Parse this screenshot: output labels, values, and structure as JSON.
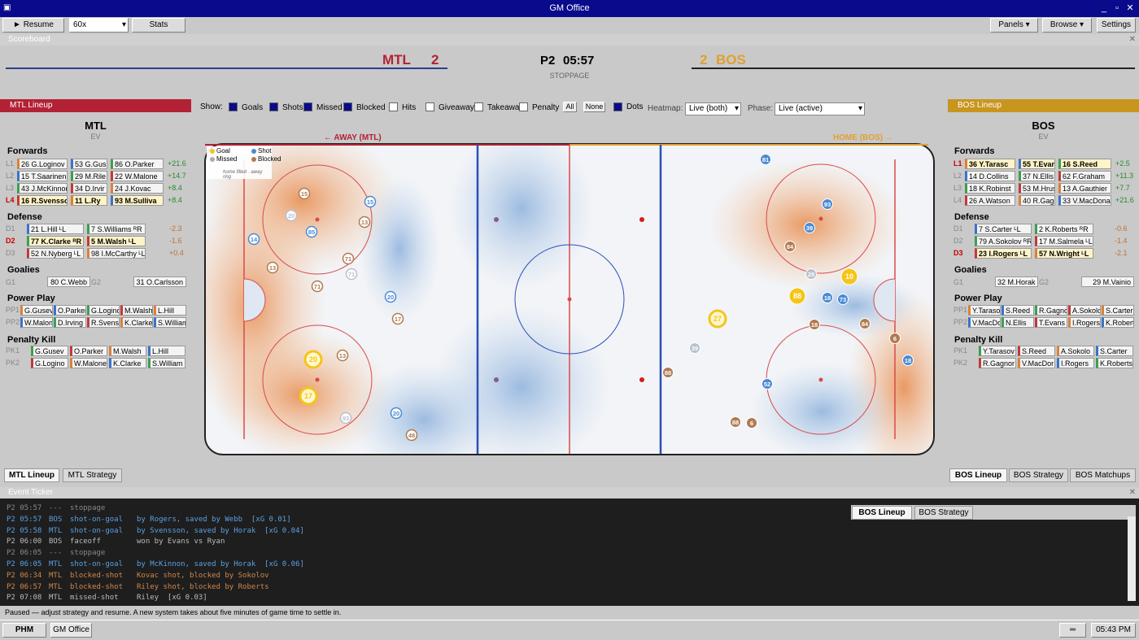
{
  "window": {
    "title": "GM Office",
    "controls": [
      "_",
      "▫",
      "✕"
    ]
  },
  "toolbar": {
    "resume": "► Resume",
    "speed": "60x",
    "stats": "Stats",
    "panels": "Panels ▾",
    "browse": "Browse ▾",
    "settings": "Settings"
  },
  "scoreboard": {
    "label": "Scoreboard",
    "home_abbr": "MTL",
    "home_score": "2",
    "away_score": "2",
    "away_abbr": "BOS",
    "period": "P2",
    "clock": "05:57",
    "status": "STOPPAGE",
    "home_color": "#b22234",
    "away_color": "#e0a030"
  },
  "mtl_panel": {
    "header": "MTL Lineup",
    "team": "MTL",
    "strength": "EV",
    "forwards_label": "Forwards",
    "defense_label": "Defense",
    "goalies_label": "Goalies",
    "pp_label": "Power Play",
    "pk_label": "Penalty Kill",
    "forwards": [
      {
        "line": "L1",
        "p": [
          "26 G.Loginov",
          "53 G.Gus",
          "86 O.Parker"
        ],
        "v": "+21.6"
      },
      {
        "line": "L2",
        "p": [
          "15 T.Saarinen",
          "29 M.Rile",
          "22 W.Malone"
        ],
        "v": "+14.7"
      },
      {
        "line": "L3",
        "p": [
          "43 J.McKinnon",
          "34 D.Irvir",
          "24 J.Kovac"
        ],
        "v": "+8.4"
      },
      {
        "line": "L4",
        "p": [
          "16 R.Svensso",
          "11 L.Ry",
          "93 M.Sulliva"
        ],
        "v": "+8.4"
      }
    ],
    "defense": [
      {
        "line": "D1",
        "p": [
          "21 L.Hill ᴸL",
          "7 S.Williams ᴿR"
        ],
        "v": "-2.3"
      },
      {
        "line": "D2",
        "p": [
          "77 K.Clarke ᴿR",
          "5 M.Walsh ᴸL"
        ],
        "v": "-1.6"
      },
      {
        "line": "D3",
        "p": [
          "52 N.Nyberg ᴸL",
          "98 I.McCarthy ᴸL"
        ],
        "v": "+0.4"
      }
    ],
    "goalies": [
      {
        "line": "G1",
        "p": "80 C.Webb"
      },
      {
        "line": "G2",
        "p": "31 O.Carlsson"
      }
    ],
    "pp": [
      {
        "line": "PP1",
        "p": [
          "G.Gusev",
          "O.Parker",
          "G.Logino",
          "M.Walsh",
          "L.Hill"
        ]
      },
      {
        "line": "PP2",
        "p": [
          "W.Malone",
          "D.Irving",
          "R.Svensso",
          "K.Clarke",
          "S.William"
        ]
      }
    ],
    "pk": [
      {
        "line": "PK1",
        "p": [
          "G.Gusev",
          "O.Parker",
          "M.Walsh",
          "L.Hill"
        ]
      },
      {
        "line": "PK2",
        "p": [
          "G.Logino",
          "W.Malone",
          "K.Clarke",
          "S.William"
        ]
      }
    ],
    "tabs": [
      "MTL Lineup",
      "MTL Strategy"
    ]
  },
  "bos_panel": {
    "header": "BOS Lineup",
    "team": "BOS",
    "strength": "EV",
    "forwards_label": "Forwards",
    "defense_label": "Defense",
    "goalies_label": "Goalies",
    "pp_label": "Power Play",
    "pk_label": "Penalty Kill",
    "forwards": [
      {
        "line": "L1",
        "p": [
          "36 Y.Tarasc",
          "55 T.Evan",
          "16 S.Reed"
        ],
        "v": "+2.5"
      },
      {
        "line": "L2",
        "p": [
          "14 D.Collins",
          "37 N.Ellis",
          "62 F.Graham"
        ],
        "v": "+11.3"
      },
      {
        "line": "L3",
        "p": [
          "18 K.Robinst",
          "53 M.Hrusk",
          "13 A.Gauthier"
        ],
        "v": "+7.7"
      },
      {
        "line": "L4",
        "p": [
          "26 A.Watson",
          "40 R.Gagnc",
          "33 V.MacDona"
        ],
        "v": "+21.6"
      }
    ],
    "defense": [
      {
        "line": "D1",
        "p": [
          "7 S.Carter ᴸL",
          "2 K.Roberts ᴿR"
        ],
        "v": "-0.6"
      },
      {
        "line": "D2",
        "p": [
          "79 A.Sokolov ᴿR",
          "17 M.Salmela ᴸL"
        ],
        "v": "-1.4"
      },
      {
        "line": "D3",
        "p": [
          "23 I.Rogers ᴸL",
          "57 N.Wright ᴸL"
        ],
        "v": "-2.1"
      }
    ],
    "goalies": [
      {
        "line": "G1",
        "p": "32 M.Horak"
      },
      {
        "line": "G2",
        "p": "29 M.Vainio"
      }
    ],
    "pp": [
      {
        "line": "PP1",
        "p": [
          "Y.Tarasov",
          "S.Reed",
          "R.Gagnor",
          "A.Sokolo",
          "S.Carter"
        ]
      },
      {
        "line": "PP2",
        "p": [
          "V.MacDor",
          "N.Ellis",
          "T.Evans",
          "I.Rogers",
          "K.Roberts"
        ]
      }
    ],
    "pk": [
      {
        "line": "PK1",
        "p": [
          "Y.Tarasov",
          "S.Reed",
          "A.Sokolo",
          "S.Carter"
        ]
      },
      {
        "line": "PK2",
        "p": [
          "R.Gagnor",
          "V.MacDor",
          "I.Rogers",
          "K.Roberts"
        ]
      }
    ],
    "tabs": [
      "BOS Lineup",
      "BOS Strategy",
      "BOS Matchups"
    ]
  },
  "filters": {
    "show_label": "Show:",
    "items": [
      {
        "label": "Goals",
        "on": true
      },
      {
        "label": "Shots",
        "on": true
      },
      {
        "label": "Missed",
        "on": true
      },
      {
        "label": "Blocked",
        "on": true
      },
      {
        "label": "Hits",
        "on": false
      },
      {
        "label": "Giveaway",
        "on": false
      },
      {
        "label": "Takeaway",
        "on": false
      },
      {
        "label": "Penalty",
        "on": false
      }
    ],
    "all": "All",
    "none": "None",
    "dots_label": "Dots",
    "heatmap_label": "Heatmap:",
    "heatmap_value": "Live (both)",
    "phase_label": "Phase:",
    "phase_value": "Live (active)"
  },
  "rink": {
    "away_label": "← AWAY (MTL)",
    "home_label": "HOME (BOS) →",
    "legend": {
      "goal": "Goal",
      "shot": "Shot",
      "missed": "Missed",
      "blocked": "Blocked",
      "note": "home filled · away ring"
    },
    "dots": [
      {
        "n": "15",
        "t": "blocked",
        "ring": true
      },
      {
        "n": "20",
        "t": "missed",
        "ring": true
      },
      {
        "n": "13",
        "t": "blocked",
        "ring": true
      },
      {
        "n": "85",
        "t": "shot",
        "ring": true
      },
      {
        "n": "14",
        "t": "shot",
        "ring": true
      },
      {
        "n": "15",
        "t": "shot",
        "ring": true
      },
      {
        "n": "71",
        "t": "blocked",
        "ring": true
      },
      {
        "n": "71",
        "t": "missed",
        "ring": true
      },
      {
        "n": "13",
        "t": "blocked",
        "ring": true
      },
      {
        "n": "71",
        "t": "blocked",
        "ring": true
      },
      {
        "n": "20",
        "t": "shot",
        "ring": true
      },
      {
        "n": "17",
        "t": "blocked",
        "ring": true
      },
      {
        "n": "20",
        "t": "goal",
        "ring": true
      },
      {
        "n": "17",
        "t": "goal",
        "ring": true
      },
      {
        "n": "13",
        "t": "blocked",
        "ring": true
      },
      {
        "n": "93",
        "t": "missed",
        "ring": true
      },
      {
        "n": "20",
        "t": "shot",
        "ring": true
      },
      {
        "n": "48",
        "t": "blocked",
        "ring": true
      },
      {
        "n": "81",
        "t": "shot"
      },
      {
        "n": "93",
        "t": "shot"
      },
      {
        "n": "39",
        "t": "shot"
      },
      {
        "n": "84",
        "t": "blocked"
      },
      {
        "n": "28",
        "t": "missed"
      },
      {
        "n": "88",
        "t": "goal"
      },
      {
        "n": "10",
        "t": "goal"
      },
      {
        "n": "18",
        "t": "shot"
      },
      {
        "n": "73",
        "t": "shot"
      },
      {
        "n": "27",
        "t": "goal",
        "ring": true
      },
      {
        "n": "39",
        "t": "missed"
      },
      {
        "n": "88",
        "t": "blocked"
      },
      {
        "n": "18",
        "t": "blocked"
      },
      {
        "n": "84",
        "t": "blocked"
      },
      {
        "n": "6",
        "t": "blocked"
      },
      {
        "n": "18",
        "t": "shot"
      },
      {
        "n": "52",
        "t": "shot"
      },
      {
        "n": "88",
        "t": "blocked"
      },
      {
        "n": "6",
        "t": "blocked"
      }
    ]
  },
  "ticker": {
    "label": "Event Ticker",
    "lines": [
      {
        "time": "P2 05:57",
        "team": "---",
        "ev": "stoppage",
        "desc": "",
        "c": "#888"
      },
      {
        "time": "P2 05:57",
        "team": "BOS",
        "ev": "shot-on-goal",
        "desc": "by Rogers, saved by Webb  [xG 0.01]",
        "c": "#5aa0e0"
      },
      {
        "time": "P2 05:58",
        "team": "MTL",
        "ev": "shot-on-goal",
        "desc": "by Svensson, saved by Horak  [xG 0.04]",
        "c": "#5aa0e0"
      },
      {
        "time": "P2 06:00",
        "team": "BOS",
        "ev": "faceoff",
        "desc": "won by Evans vs Ryan",
        "c": "#bbbbbb"
      },
      {
        "time": "P2 06:05",
        "team": "---",
        "ev": "stoppage",
        "desc": "",
        "c": "#888"
      },
      {
        "time": "P2 06:05",
        "team": "MTL",
        "ev": "shot-on-goal",
        "desc": "by McKinnon, saved by Horak  [xG 0.06]",
        "c": "#5aa0e0"
      },
      {
        "time": "P2 06:34",
        "team": "MTL",
        "ev": "blocked-shot",
        "desc": "Kovac shot, blocked by Sokolov",
        "c": "#d2874a"
      },
      {
        "time": "P2 06:57",
        "team": "MTL",
        "ev": "blocked-shot",
        "desc": "Riley shot, blocked by Roberts",
        "c": "#d2874a"
      },
      {
        "time": "P2 07:08",
        "team": "MTL",
        "ev": "missed-shot",
        "desc": "Riley  [xG 0.03]",
        "c": "#bbbbbb"
      }
    ],
    "tabs": [
      "BOS Lineup",
      "BOS Strategy"
    ]
  },
  "status": {
    "text": "Paused — adjust strategy and resume. A new system takes about five minutes of game time to settle in."
  },
  "taskbar": {
    "start": "PHM",
    "app": "GM Office",
    "time": "05:43 PM"
  }
}
